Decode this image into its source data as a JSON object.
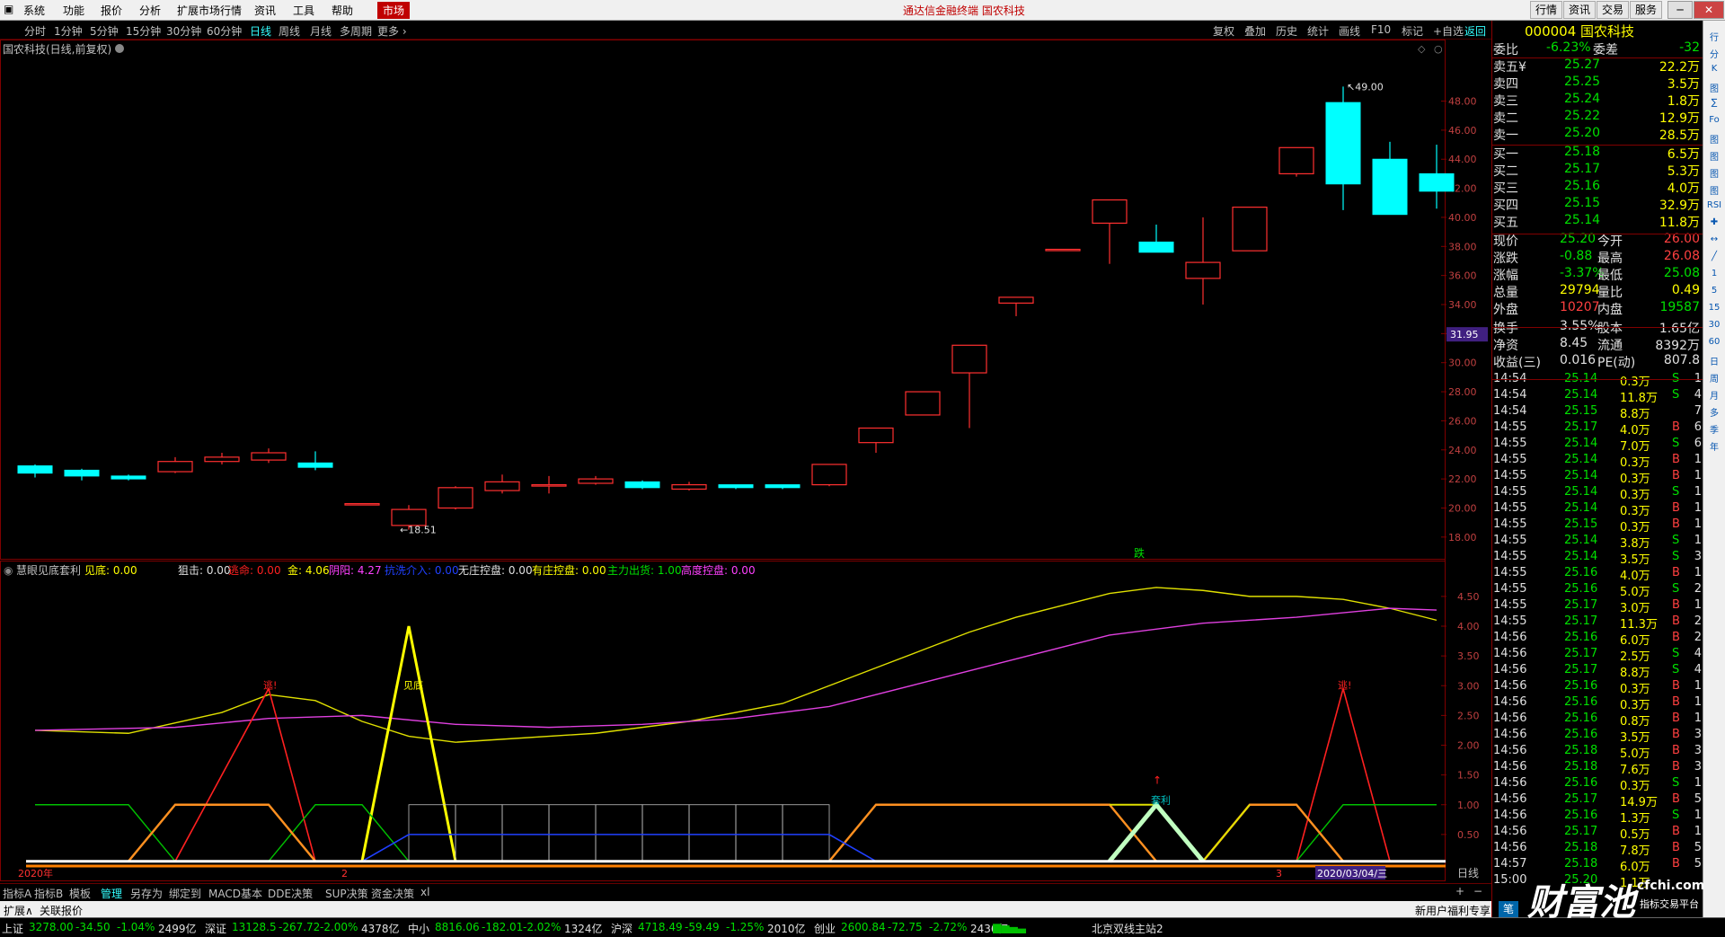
{
  "menu": {
    "items": [
      "系统",
      "功能",
      "报价",
      "分析",
      "扩展市场行情",
      "资讯",
      "工具",
      "帮助"
    ],
    "market": "市场",
    "center_title": "通达信金融终端  国农科技",
    "right_buttons": [
      "行情",
      "资讯",
      "交易",
      "服务"
    ]
  },
  "periods": [
    "分时",
    "1分钟",
    "5分钟",
    "15分钟",
    "30分钟",
    "60分钟",
    "日线",
    "周线",
    "月线",
    "多周期",
    "更多 ›"
  ],
  "active_period": "日线",
  "tools": [
    "复权",
    "叠加",
    "历史",
    "统计",
    "画线",
    "F10",
    "标记",
    "+自选",
    "返回"
  ],
  "chart": {
    "title": "国农科技(日线,前复权)",
    "price_marker": "31.95",
    "high_label": "49.00",
    "low_label": "18.51",
    "drop_label": "跌",
    "y_ticks": [
      "48.00",
      "46.00",
      "44.00",
      "42.00",
      "40.00",
      "38.00",
      "36.00",
      "34.00",
      "32.00",
      "30.00",
      "28.00",
      "26.00",
      "24.00",
      "22.00",
      "20.00",
      "18.00"
    ]
  },
  "chart_data": {
    "type": "candlestick",
    "y_range": [
      17,
      51
    ],
    "candles": [
      {
        "o": 22.9,
        "c": 22.4,
        "h": 23.0,
        "l": 22.1
      },
      {
        "o": 22.6,
        "c": 22.2,
        "h": 22.7,
        "l": 21.9
      },
      {
        "o": 22.2,
        "c": 22.0,
        "h": 22.3,
        "l": 21.9
      },
      {
        "o": 22.5,
        "c": 23.2,
        "h": 23.5,
        "l": 22.4
      },
      {
        "o": 23.2,
        "c": 23.5,
        "h": 23.8,
        "l": 23.0
      },
      {
        "o": 23.3,
        "c": 23.8,
        "h": 24.1,
        "l": 23.1
      },
      {
        "o": 23.1,
        "c": 22.8,
        "h": 23.9,
        "l": 22.6
      },
      {
        "o": 20.3,
        "c": 20.3,
        "h": 20.3,
        "l": 20.3
      },
      {
        "o": 18.8,
        "c": 19.9,
        "h": 20.2,
        "l": 18.51
      },
      {
        "o": 20.0,
        "c": 21.4,
        "h": 21.5,
        "l": 19.9
      },
      {
        "o": 21.2,
        "c": 21.8,
        "h": 22.3,
        "l": 21.0
      },
      {
        "o": 21.6,
        "c": 21.6,
        "h": 22.2,
        "l": 21.0
      },
      {
        "o": 21.7,
        "c": 22.0,
        "h": 22.2,
        "l": 21.6
      },
      {
        "o": 21.8,
        "c": 21.4,
        "h": 21.9,
        "l": 21.3
      },
      {
        "o": 21.3,
        "c": 21.6,
        "h": 21.8,
        "l": 21.2
      },
      {
        "o": 21.6,
        "c": 21.4,
        "h": 21.6,
        "l": 21.3
      },
      {
        "o": 21.6,
        "c": 21.4,
        "h": 21.6,
        "l": 21.3
      },
      {
        "o": 21.6,
        "c": 23.0,
        "h": 23.0,
        "l": 21.5
      },
      {
        "o": 24.5,
        "c": 25.5,
        "h": 25.5,
        "l": 23.8
      },
      {
        "o": 26.4,
        "c": 28.0,
        "h": 28.0,
        "l": 26.4
      },
      {
        "o": 29.3,
        "c": 31.2,
        "h": 31.2,
        "l": 25.5
      },
      {
        "o": 34.1,
        "c": 34.5,
        "h": 34.5,
        "l": 33.2
      },
      {
        "o": 37.8,
        "c": 37.8,
        "h": 37.8,
        "l": 37.8
      },
      {
        "o": 39.6,
        "c": 41.2,
        "h": 41.2,
        "l": 36.8
      },
      {
        "o": 38.3,
        "c": 37.6,
        "h": 39.5,
        "l": 37.6
      },
      {
        "o": 35.8,
        "c": 36.9,
        "h": 40.0,
        "l": 34.0
      },
      {
        "o": 37.7,
        "c": 40.7,
        "h": 40.7,
        "l": 37.7
      },
      {
        "o": 43.0,
        "c": 44.8,
        "h": 44.8,
        "l": 42.8
      },
      {
        "o": 47.9,
        "c": 42.3,
        "h": 49.0,
        "l": 40.5
      },
      {
        "o": 44.0,
        "c": 40.2,
        "h": 45.2,
        "l": 40.2
      },
      {
        "o": 43.0,
        "c": 41.8,
        "h": 45.0,
        "l": 40.6
      }
    ]
  },
  "indicator": {
    "name": "慧眼见底套利",
    "params": [
      {
        "t": "见底: 0.00",
        "c": "#ffff00"
      },
      {
        "t": "狙击: 0.00",
        "c": "#e0e0e0"
      },
      {
        "t": "逃命: 0.00",
        "c": "#ff2020"
      },
      {
        "t": "金: 4.06",
        "c": "#ffff00"
      },
      {
        "t": "阴阳: 4.27",
        "c": "#ff40ff"
      },
      {
        "t": "抗洗介入: 0.00",
        "c": "#2040ff"
      },
      {
        "t": "无庄控盘: 0.00",
        "c": "#e0e0e0"
      },
      {
        "t": "有庄控盘: 0.00",
        "c": "#ffff00"
      },
      {
        "t": "主力出货: 1.00",
        "c": "#00e000"
      },
      {
        "t": "高度控盘: 0.00",
        "c": "#ff40ff"
      }
    ],
    "y_ticks": [
      "4.50",
      "4.00",
      "3.50",
      "3.00",
      "2.50",
      "2.00",
      "1.50",
      "1.00",
      "0.50"
    ],
    "labels": {
      "escape1": "逃!",
      "bottom": "见底",
      "arb": "套利",
      "escape2": "逃!"
    },
    "date_labels": [
      "2020年",
      "2",
      "3"
    ],
    "current_date": "2020/03/04/三",
    "period": "日线"
  },
  "quote": {
    "code_name": "000004 国农科技",
    "wb_label": "委比",
    "wb": "-6.23%",
    "wc_label": "委差",
    "wc": "-32",
    "asks": [
      {
        "label": "卖五",
        "mark": "¥",
        "price": "25.27",
        "vol": "22.2万"
      },
      {
        "label": "卖四",
        "price": "25.25",
        "vol": "3.5万"
      },
      {
        "label": "卖三",
        "price": "25.24",
        "vol": "1.8万"
      },
      {
        "label": "卖二",
        "price": "25.22",
        "vol": "12.9万"
      },
      {
        "label": "卖一",
        "price": "25.20",
        "vol": "28.5万"
      }
    ],
    "bids": [
      {
        "label": "买一",
        "price": "25.18",
        "vol": "6.5万"
      },
      {
        "label": "买二",
        "price": "25.17",
        "vol": "5.3万"
      },
      {
        "label": "买三",
        "price": "25.16",
        "vol": "4.0万"
      },
      {
        "label": "买四",
        "price": "25.15",
        "vol": "32.9万"
      },
      {
        "label": "买五",
        "price": "25.14",
        "vol": "11.8万"
      }
    ],
    "stats": [
      {
        "l1": "现价",
        "v1": "25.20",
        "c1": "green",
        "l2": "今开",
        "v2": "26.00",
        "c2": "red"
      },
      {
        "l1": "涨跌",
        "v1": "-0.88",
        "c1": "green",
        "l2": "最高",
        "v2": "26.08",
        "c2": "red"
      },
      {
        "l1": "涨幅",
        "v1": "-3.37%",
        "c1": "green",
        "l2": "最低",
        "v2": "25.08",
        "c2": "green"
      },
      {
        "l1": "总量",
        "v1": "29794",
        "c1": "yellow",
        "l2": "量比",
        "v2": "0.49",
        "c2": "yellow"
      },
      {
        "l1": "外盘",
        "v1": "10207",
        "c1": "red",
        "l2": "内盘",
        "v2": "19587",
        "c2": "green"
      }
    ],
    "stats2": [
      {
        "l1": "换手",
        "v1": "3.55%",
        "l2": "股本",
        "v2": "1.65亿"
      },
      {
        "l1": "净资",
        "v1": "8.45",
        "l2": "流通",
        "v2": "8392万"
      },
      {
        "l1": "收益(三)",
        "v1": "0.016",
        "l2": "PE(动)",
        "v2": "807.8"
      }
    ],
    "ticks": [
      {
        "t": "14:54",
        "p": "25.14",
        "v": "0.3万",
        "s": "S",
        "n": "1"
      },
      {
        "t": "14:54",
        "p": "25.14",
        "v": "11.8万",
        "s": "S",
        "n": "4"
      },
      {
        "t": "14:54",
        "p": "25.15",
        "v": "8.8万",
        "s": "",
        "n": "7"
      },
      {
        "t": "14:55",
        "p": "25.17",
        "v": "4.0万",
        "s": "B",
        "n": "6"
      },
      {
        "t": "14:55",
        "p": "25.14",
        "v": "7.0万",
        "s": "S",
        "n": "6"
      },
      {
        "t": "14:55",
        "p": "25.14",
        "v": "0.3万",
        "s": "B",
        "n": "1"
      },
      {
        "t": "14:55",
        "p": "25.14",
        "v": "0.3万",
        "s": "B",
        "n": "1"
      },
      {
        "t": "14:55",
        "p": "25.14",
        "v": "0.3万",
        "s": "S",
        "n": "1"
      },
      {
        "t": "14:55",
        "p": "25.14",
        "v": "0.3万",
        "s": "B",
        "n": "1"
      },
      {
        "t": "14:55",
        "p": "25.15",
        "v": "0.3万",
        "s": "B",
        "n": "1"
      },
      {
        "t": "14:55",
        "p": "25.14",
        "v": "3.8万",
        "s": "S",
        "n": "1"
      },
      {
        "t": "14:55",
        "p": "25.14",
        "v": "3.5万",
        "s": "S",
        "n": "3"
      },
      {
        "t": "14:55",
        "p": "25.16",
        "v": "4.0万",
        "s": "B",
        "n": "1"
      },
      {
        "t": "14:55",
        "p": "25.16",
        "v": "5.0万",
        "s": "S",
        "n": "2"
      },
      {
        "t": "14:55",
        "p": "25.17",
        "v": "3.0万",
        "s": "B",
        "n": "1"
      },
      {
        "t": "14:55",
        "p": "25.17",
        "v": "11.3万",
        "s": "B",
        "n": "2"
      },
      {
        "t": "14:56",
        "p": "25.16",
        "v": "6.0万",
        "s": "B",
        "n": "2"
      },
      {
        "t": "14:56",
        "p": "25.17",
        "v": "2.5万",
        "s": "S",
        "n": "4"
      },
      {
        "t": "14:56",
        "p": "25.17",
        "v": "8.8万",
        "s": "S",
        "n": "4"
      },
      {
        "t": "14:56",
        "p": "25.16",
        "v": "0.3万",
        "s": "B",
        "n": "1"
      },
      {
        "t": "14:56",
        "p": "25.16",
        "v": "0.3万",
        "s": "B",
        "n": "1"
      },
      {
        "t": "14:56",
        "p": "25.16",
        "v": "0.8万",
        "s": "B",
        "n": "1"
      },
      {
        "t": "14:56",
        "p": "25.16",
        "v": "3.5万",
        "s": "B",
        "n": "3"
      },
      {
        "t": "14:56",
        "p": "25.18",
        "v": "5.0万",
        "s": "B",
        "n": "3"
      },
      {
        "t": "14:56",
        "p": "25.18",
        "v": "7.6万",
        "s": "B",
        "n": "3"
      },
      {
        "t": "14:56",
        "p": "25.16",
        "v": "0.3万",
        "s": "S",
        "n": "1"
      },
      {
        "t": "14:56",
        "p": "25.17",
        "v": "14.9万",
        "s": "B",
        "n": "5"
      },
      {
        "t": "14:56",
        "p": "25.16",
        "v": "1.3万",
        "s": "S",
        "n": "1"
      },
      {
        "t": "14:56",
        "p": "25.17",
        "v": "0.5万",
        "s": "B",
        "n": "1"
      },
      {
        "t": "14:56",
        "p": "25.18",
        "v": "7.8万",
        "s": "B",
        "n": "5"
      },
      {
        "t": "14:57",
        "p": "25.18",
        "v": "6.0万",
        "s": "B",
        "n": "5"
      },
      {
        "t": "15:00",
        "p": "25.20",
        "v": "1.1万",
        "s": "",
        "n": ""
      }
    ]
  },
  "tabs": [
    "指标A",
    "指标B",
    "模板",
    "管理",
    "另存为",
    "绑定到",
    "MACD基本",
    "DDE决策",
    "SUP决策",
    "资金决策",
    "xl"
  ],
  "active_tab": "管理",
  "expand_bar": [
    "扩展∧",
    "关联报价"
  ],
  "status": [
    {
      "name": "上证",
      "val": "3278.00",
      "chg": "-34.50",
      "pct": "-1.04%",
      "amt": "2499亿"
    },
    {
      "name": "深证",
      "val": "13128.5",
      "chg": "-267.72",
      "pct": "-2.00%",
      "amt": "4378亿"
    },
    {
      "name": "中小",
      "val": "8816.06",
      "chg": "-182.01",
      "pct": "-2.02%",
      "amt": "1324亿"
    },
    {
      "name": "沪深",
      "val": "4718.49",
      "chg": "-59.49",
      "pct": "-1.25%",
      "amt": "2010亿"
    },
    {
      "name": "创业",
      "val": "2600.84",
      "chg": "-72.75",
      "pct": "-2.72%",
      "amt": "2436亿"
    }
  ],
  "server": "北京双线主站2",
  "promo": "新用户福利专享",
  "logo_text": "财富池",
  "logo_url": "cfchi.com",
  "logo_sub": "指标交易平台",
  "sidebar_icons": [
    "行",
    "分",
    "K",
    "图",
    "∑",
    "Fo",
    "图",
    "图",
    "图",
    "图",
    "RSI",
    "✚",
    "↔",
    "╱",
    "1",
    "5",
    "15",
    "30",
    "60",
    "日",
    "周",
    "月",
    "多",
    "季",
    "年"
  ],
  "colors": {
    "up": "#ff3030",
    "down": "#00ffff",
    "bg": "#000000",
    "frame": "#800000"
  }
}
